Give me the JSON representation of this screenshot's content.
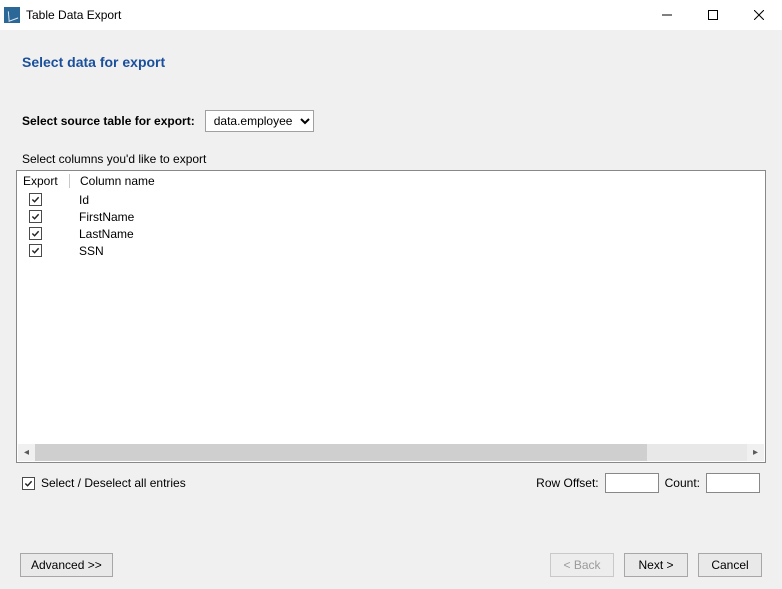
{
  "window": {
    "title": "Table Data Export"
  },
  "page": {
    "title": "Select data for export"
  },
  "source": {
    "label": "Select source table for export:",
    "selected": "data.employee"
  },
  "columns": {
    "hint": "Select columns you'd like to export",
    "headers": {
      "export": "Export",
      "name": "Column name"
    },
    "rows": [
      {
        "checked": true,
        "name": "Id"
      },
      {
        "checked": true,
        "name": "FirstName"
      },
      {
        "checked": true,
        "name": "LastName"
      },
      {
        "checked": true,
        "name": "SSN"
      }
    ]
  },
  "selectAll": {
    "checked": true,
    "label": "Select / Deselect all entries"
  },
  "offset": {
    "label": "Row Offset:",
    "value": ""
  },
  "count": {
    "label": "Count:",
    "value": ""
  },
  "buttons": {
    "advanced": "Advanced >>",
    "back": "< Back",
    "next": "Next >",
    "cancel": "Cancel"
  }
}
